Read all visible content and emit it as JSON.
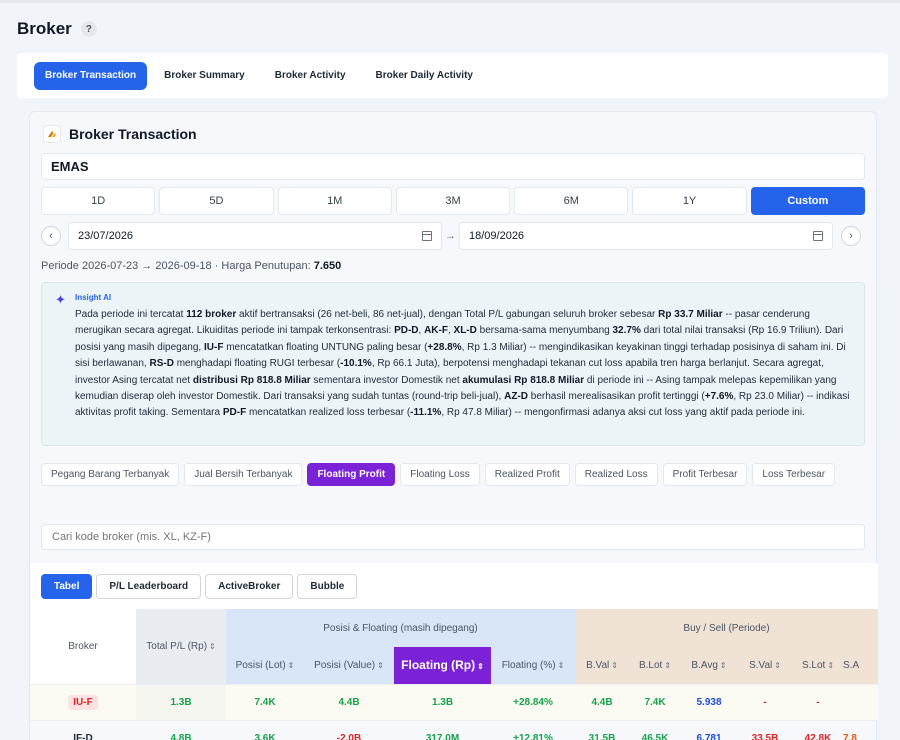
{
  "page": {
    "title": "Broker",
    "help": "?"
  },
  "tabs": [
    {
      "label": "Broker Transaction",
      "active": true
    },
    {
      "label": "Broker Summary"
    },
    {
      "label": "Broker Activity"
    },
    {
      "label": "Broker Daily Activity"
    }
  ],
  "card": {
    "title": "Broker Transaction",
    "ticker": "EMAS",
    "periods": [
      "1D",
      "5D",
      "1M",
      "3M",
      "6M",
      "1Y",
      "Custom"
    ],
    "active_period": "Custom",
    "date_from": "23/07/2026",
    "date_to": "18/09/2026",
    "period_label": "Periode 2026-07-23 → 2026-09-18 · Harga Penutupan: ",
    "close_price": "7.650"
  },
  "insight": {
    "label": "Insight AI",
    "segments": [
      [
        "Pada periode ini tercatat ",
        0
      ],
      [
        "112 broker",
        1
      ],
      [
        " aktif bertransaksi (26 net-beli, 86 net-jual), dengan Total P/L gabungan seluruh broker sebesar ",
        0
      ],
      [
        "Rp 33.7 Miliar",
        1
      ],
      [
        " -- pasar cenderung merugikan secara agregat. Likuiditas periode ini tampak terkonsentrasi: ",
        0
      ],
      [
        "PD-D",
        1
      ],
      [
        ", ",
        0
      ],
      [
        "AK-F",
        1
      ],
      [
        ", ",
        0
      ],
      [
        "XL-D",
        1
      ],
      [
        " bersama-sama menyumbang ",
        0
      ],
      [
        "32.7%",
        1
      ],
      [
        " dari total nilai transaksi (Rp 16.9 Triliun). Dari posisi yang masih dipegang, ",
        0
      ],
      [
        "IU-F",
        1
      ],
      [
        " mencatatkan floating UNTUNG paling besar (",
        0
      ],
      [
        "+28.8%",
        1
      ],
      [
        ", Rp 1.3 Miliar) -- mengindikasikan keyakinan tinggi terhadap posisinya di saham ini. Di sisi berlawanan, ",
        0
      ],
      [
        "RS-D",
        1
      ],
      [
        " menghadapi floating RUGI terbesar (",
        0
      ],
      [
        "-10.1%",
        1
      ],
      [
        ", Rp 66.1 Juta), berpotensi menghadapi tekanan cut loss apabila tren harga berlanjut. Secara agregat, investor Asing tercatat net ",
        0
      ],
      [
        "distribusi Rp 818.8 Miliar",
        1
      ],
      [
        " sementara investor Domestik net ",
        0
      ],
      [
        "akumulasi Rp 818.8 Miliar",
        1
      ],
      [
        " di periode ini -- Asing tampak melepas kepemilikan yang kemudian diserap oleh investor Domestik. Dari transaksi yang sudah tuntas (round-trip beli-jual), ",
        0
      ],
      [
        "AZ-D",
        1
      ],
      [
        " berhasil merealisasikan profit tertinggi (",
        0
      ],
      [
        "+7.6%",
        1
      ],
      [
        ", Rp 23.0 Miliar) -- indikasi aktivitas profit taking. Sementara ",
        0
      ],
      [
        "PD-F",
        1
      ],
      [
        " mencatatkan realized loss terbesar (",
        0
      ],
      [
        "-11.1%",
        1
      ],
      [
        ", Rp 47.8 Miliar) -- mengonfirmasi adanya aksi cut loss yang aktif pada periode ini.",
        0
      ]
    ]
  },
  "filters": [
    "Pegang Barang Terbanyak",
    "Jual Bersih Terbanyak",
    "Floating Profit",
    "Floating Loss",
    "Realized Profit",
    "Realized Loss",
    "Profit Terbesar",
    "Loss Terbesar"
  ],
  "active_filter": "Floating Profit",
  "search": {
    "placeholder": "Cari kode broker (mis. XL, KZ-F)"
  },
  "views": [
    "Tabel",
    "P/L Leaderboard",
    "ActiveBroker",
    "Bubble"
  ],
  "active_view": "Tabel",
  "table": {
    "group_pos": "Posisi & Floating (masih dipegang)",
    "group_bs": "Buy / Sell (Periode)",
    "columns": {
      "broker": "Broker",
      "total": "Total P/L (Rp)",
      "pos_lot": "Posisi (Lot)",
      "pos_val": "Posisi (Value)",
      "floating": "Floating (Rp)",
      "floating_pct": "Floating (%)",
      "bval": "B.Val",
      "blot": "B.Lot",
      "bavg": "B.Avg",
      "sval": "S.Val",
      "slot": "S.Lot",
      "sa": "S.A"
    },
    "sort_glyph": "⇕",
    "rows": [
      {
        "broker": "IU-F",
        "total": "1.3B",
        "pos_lot": "7.4K",
        "pos_val": "4.4B",
        "floating": "1.3B",
        "floating_pct": "+28.84%",
        "bval": "4.4B",
        "blot": "7.4K",
        "bavg": "5.938",
        "sval": "-",
        "slot": "-",
        "sa": ""
      },
      {
        "broker": "IF-D",
        "total": "4.8B",
        "pos_lot": "3.6K",
        "pos_val": "-2.0B",
        "floating": "317.0M",
        "floating_pct": "+12.81%",
        "bval": "31.5B",
        "blot": "46.5K",
        "bavg": "6.781",
        "sval": "33.5B",
        "slot": "42.8K",
        "sa": "7.8"
      }
    ]
  }
}
